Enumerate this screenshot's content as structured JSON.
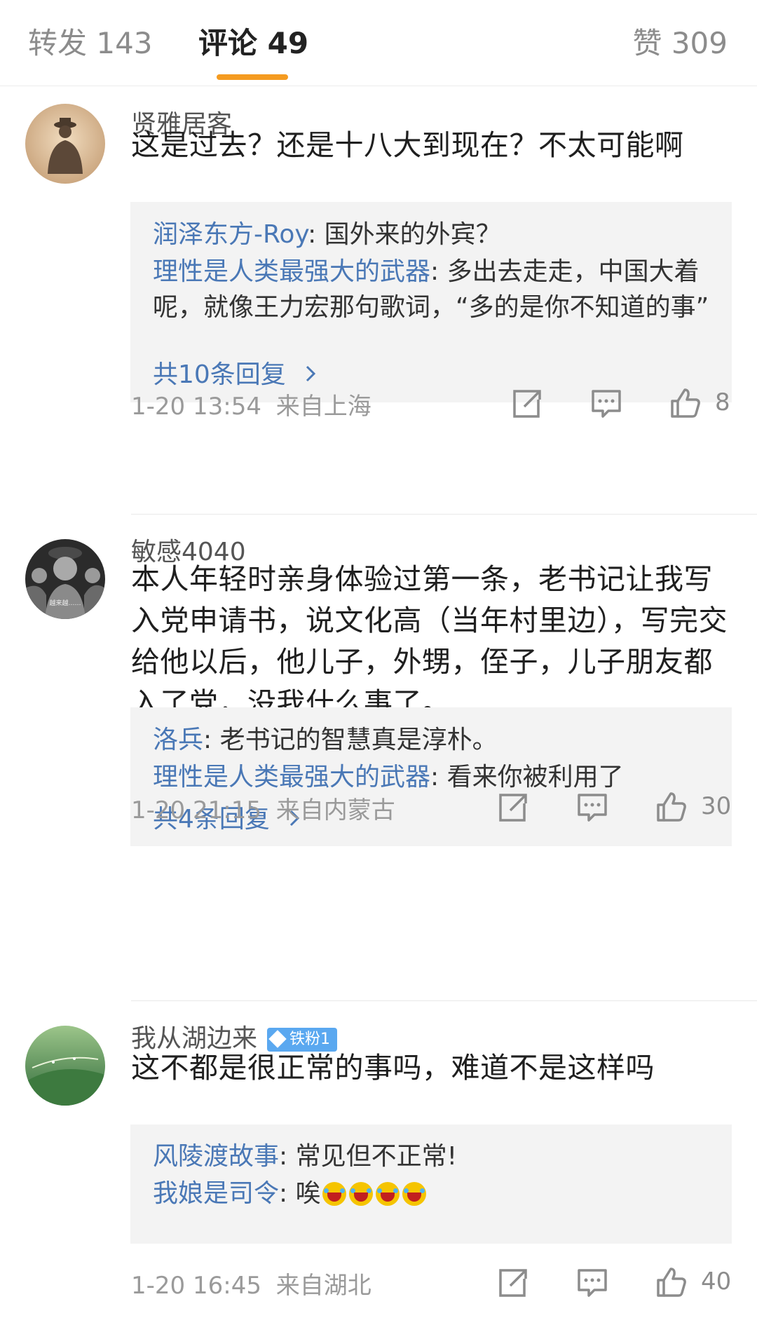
{
  "tabs": {
    "repost": "转发 143",
    "comment": "评论 49",
    "like": "赞 309"
  },
  "comments": [
    {
      "username": "贤雅居客",
      "text": "这是过去？还是十八大到现在？不太可能啊",
      "replies": [
        {
          "author": "润泽东方-Roy",
          "text": ": 国外来的外宾？"
        },
        {
          "author": "理性是人类最强大的武器",
          "text": ": 多出去走走，中国大着呢，就像王力宏那句歌词，“多的是你不知道的事”"
        }
      ],
      "more_replies": "共10条回复",
      "time": "1-20 13:54",
      "location": "来自上海",
      "likes": "8"
    },
    {
      "username": "敏感4040",
      "text": "本人年轻时亲身体验过第一条，老书记让我写入党申请书，说文化高（当年村里边），写完交给他以后，他儿子，外甥，侄子，儿子朋友都入了党，没我什么事了。",
      "avatar_caption": "越来越……",
      "replies": [
        {
          "author": "洛兵",
          "text": ": 老书记的智慧真是淳朴。"
        },
        {
          "author": "理性是人类最强大的武器",
          "text": ": 看来你被利用了"
        }
      ],
      "more_replies": "共4条回复",
      "time": "1-20 21:15",
      "location": "来自内蒙古",
      "likes": "30"
    },
    {
      "username": "我从湖边来",
      "badge": "铁粉1",
      "text": "这不都是很正常的事吗，难道不是这样吗",
      "replies": [
        {
          "author": "风陵渡故事",
          "text": ": 常见但不正常!"
        },
        {
          "author": "我娘是司令",
          "text": ": 唉"
        }
      ],
      "time": "1-20 16:45",
      "location": "来自湖北",
      "likes": "40"
    }
  ],
  "icons": {
    "share": "share-icon",
    "comment": "comment-icon",
    "like": "thumbs-up-icon",
    "chevron": "chevron-right-icon",
    "emoji": "laughing-tears-emoji-icon"
  },
  "colors": {
    "accent": "#f59b20",
    "link": "#4a78b6",
    "muted": "#9a9a9a",
    "reply_bg": "#f3f3f3",
    "badge": "#5aa8f0"
  }
}
